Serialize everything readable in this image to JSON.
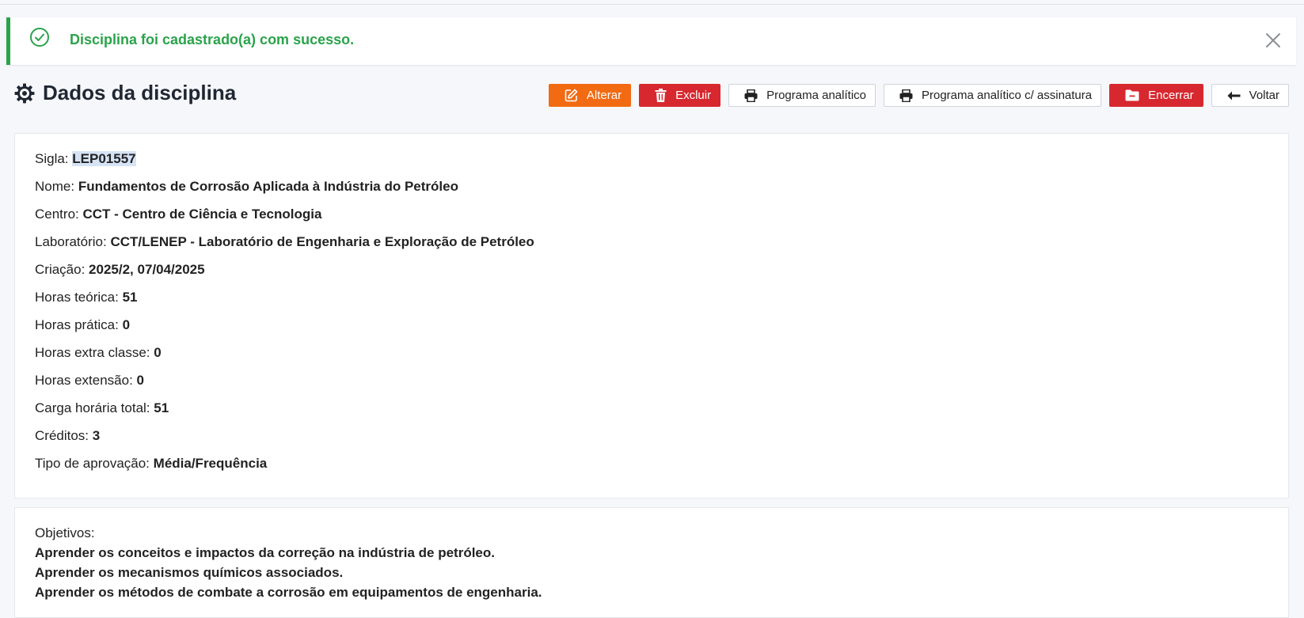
{
  "alert": {
    "message": "Disciplina foi cadastrado(a) com sucesso.",
    "status_color": "#2aa34a"
  },
  "header": {
    "title": "Dados da disciplina",
    "icon": "gear-icon"
  },
  "actions": {
    "alterar": "Alterar",
    "excluir": "Excluir",
    "programa_analitico": "Programa analítico",
    "programa_assinatura": "Programa analítico c/ assinatura",
    "encerrar": "Encerrar",
    "voltar": "Voltar"
  },
  "details": {
    "sigla": {
      "label": "Sigla:",
      "value": "LEP01557"
    },
    "nome": {
      "label": "Nome:",
      "value": "Fundamentos de Corrosão Aplicada à Indústria do Petróleo"
    },
    "centro": {
      "label": "Centro:",
      "value": "CCT - Centro de Ciência e Tecnologia"
    },
    "laboratorio": {
      "label": "Laboratório:",
      "value": "CCT/LENEP - Laboratório de Engenharia e Exploração de Petróleo"
    },
    "criacao": {
      "label": "Criação:",
      "value": "2025/2, 07/04/2025"
    },
    "horas_teorica": {
      "label": "Horas teórica:",
      "value": "51"
    },
    "horas_pratica": {
      "label": "Horas prática:",
      "value": "0"
    },
    "horas_extra": {
      "label": "Horas extra classe:",
      "value": "0"
    },
    "horas_extensao": {
      "label": "Horas extensão:",
      "value": "0"
    },
    "carga_total": {
      "label": "Carga horária total:",
      "value": "51"
    },
    "creditos": {
      "label": "Créditos:",
      "value": "3"
    },
    "tipo_aprovacao": {
      "label": "Tipo de aprovação:",
      "value": "Média/Frequência"
    }
  },
  "objectives": {
    "label": "Objetivos:",
    "lines": [
      "Aprender os conceitos e impactos da correção na indústria de petróleo.",
      "Aprender os mecanismos químicos associados.",
      "Aprender os métodos de combate a corrosão em equipamentos de engenharia."
    ]
  }
}
